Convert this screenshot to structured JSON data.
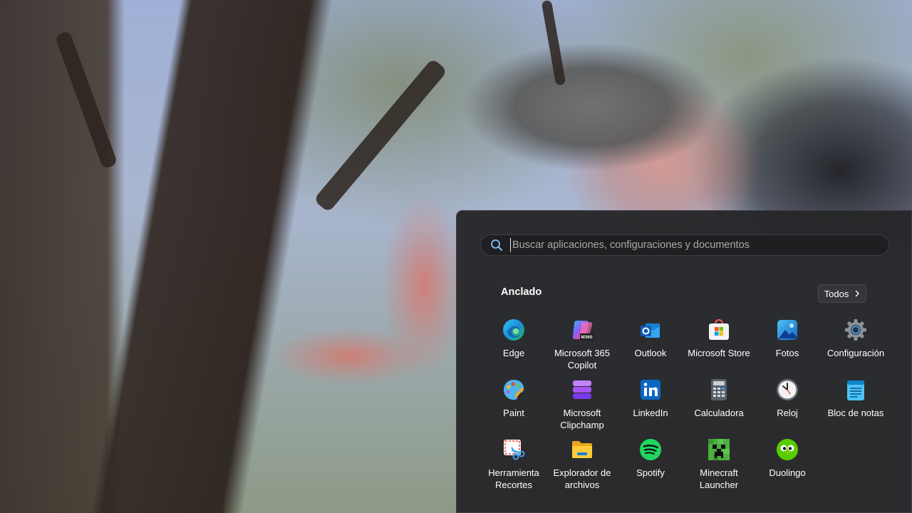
{
  "search": {
    "placeholder": "Buscar aplicaciones, configuraciones y documentos",
    "icon": "search-icon"
  },
  "pinned": {
    "title": "Anclado",
    "all_label": "Todos"
  },
  "apps": [
    {
      "label": "Edge",
      "icon": "edge-icon"
    },
    {
      "label": "Microsoft 365 Copilot",
      "icon": "m365-copilot-icon",
      "badge": "M365"
    },
    {
      "label": "Outlook",
      "icon": "outlook-icon"
    },
    {
      "label": "Microsoft Store",
      "icon": "store-icon"
    },
    {
      "label": "Fotos",
      "icon": "photos-icon"
    },
    {
      "label": "Configuración",
      "icon": "gear-icon"
    },
    {
      "label": "Paint",
      "icon": "paint-icon"
    },
    {
      "label": "Microsoft Clipchamp",
      "icon": "clipchamp-icon"
    },
    {
      "label": "LinkedIn",
      "icon": "linkedin-icon",
      "badge": "in"
    },
    {
      "label": "Calculadora",
      "icon": "calculator-icon"
    },
    {
      "label": "Reloj",
      "icon": "clock-icon"
    },
    {
      "label": "Bloc de notas",
      "icon": "notepad-icon"
    },
    {
      "label": "Herramienta Recortes",
      "icon": "snipping-tool-icon"
    },
    {
      "label": "Explorador de archivos",
      "icon": "folder-icon"
    },
    {
      "label": "Spotify",
      "icon": "spotify-icon"
    },
    {
      "label": "Minecraft Launcher",
      "icon": "minecraft-icon"
    },
    {
      "label": "Duolingo",
      "icon": "duolingo-icon"
    }
  ]
}
